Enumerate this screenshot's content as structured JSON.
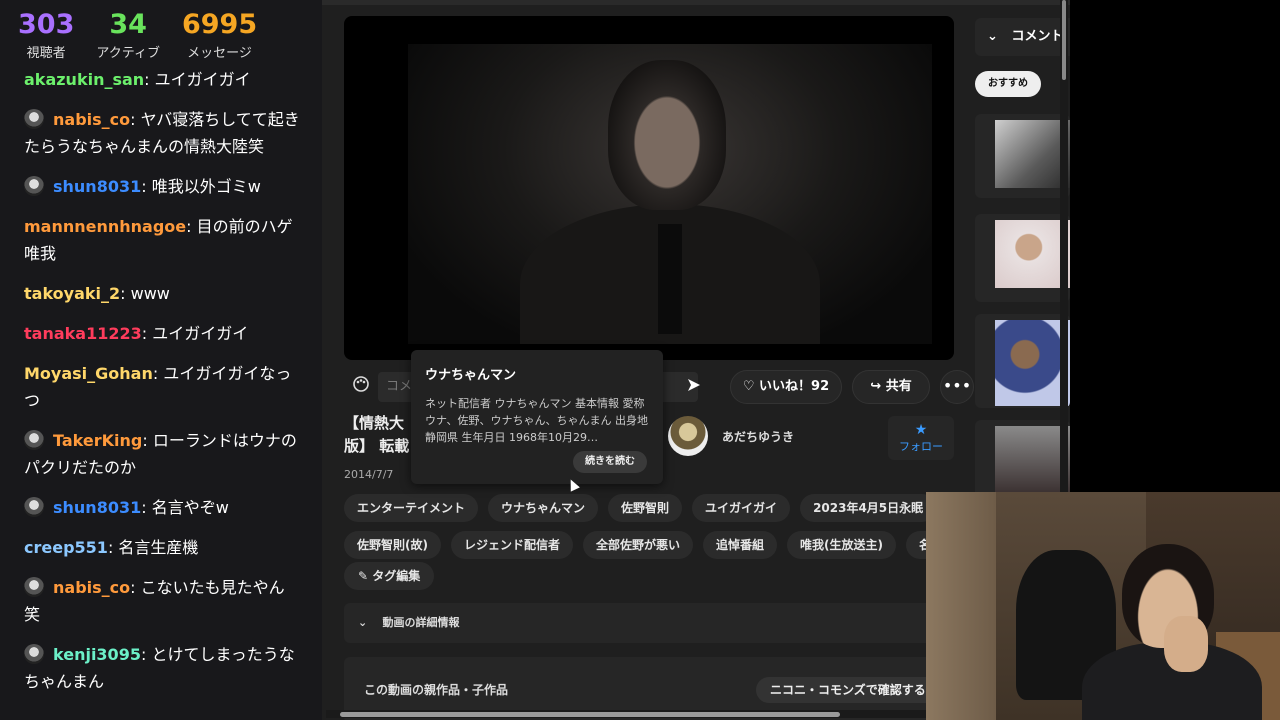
{
  "stats": [
    {
      "num": "303",
      "label": "視聴者",
      "color": "#a970ff"
    },
    {
      "num": "34",
      "label": "アクティブ",
      "color": "#69e35c"
    },
    {
      "num": "6995",
      "label": "メッセージ",
      "color": "#f5a623"
    }
  ],
  "chat": [
    {
      "user": "akazukin_san",
      "text": "ユイガイガイ",
      "color": "#6cf06c",
      "badge": false
    },
    {
      "user": "nabis_co",
      "text": "ヤバ寝落ちしてて起きたらうなちゃんまんの情熱大陸笑",
      "color": "#ff9a3c",
      "badge": true
    },
    {
      "user": "shun8031",
      "text": "唯我以外ゴミw",
      "color": "#3c8cff",
      "badge": true
    },
    {
      "user": "mannnennhnagoe",
      "text": "目の前のハゲ唯我",
      "color": "#ff9a3c",
      "badge": false
    },
    {
      "user": "takoyaki_2",
      "text": "www",
      "color": "#ffd76a",
      "badge": false
    },
    {
      "user": "tanaka11223",
      "text": "ユイガイガイ",
      "color": "#ff3c5c",
      "badge": false
    },
    {
      "user": "Moyasi_Gohan",
      "text": "ユイガイガイなっつ",
      "color": "#ffd76a",
      "badge": false
    },
    {
      "user": "TakerKing",
      "text": "ローランドはウナのパクリだたのか",
      "color": "#ff9a3c",
      "badge": true
    },
    {
      "user": "shun8031",
      "text": "名言やぞw",
      "color": "#3c8cff",
      "badge": true
    },
    {
      "user": "creep551",
      "text": "名言生産機",
      "color": "#8cc8ff",
      "badge": false
    },
    {
      "user": "nabis_co",
      "text": "こないたも見たやん笑",
      "color": "#ff9a3c",
      "badge": true
    },
    {
      "user": "kenji3095",
      "text": "とけてしまったうなちゃんまん",
      "color": "#6cf0c8",
      "badge": true
    }
  ],
  "player": {
    "comment_placeholder": "コメ",
    "like_label": "いいね！92",
    "share_label": "共有",
    "more_label": "•••"
  },
  "video": {
    "title_line1": "【情熱大",
    "title_line2": "版】 転載",
    "date": "2014/7/7",
    "owner_name": "あだちゆうき",
    "follow_label": "フォロー"
  },
  "tags_row1": [
    "エンターテイメント",
    "ウナちゃんマン",
    "佐野智則",
    "ユイガイガイ",
    "2023年4月5日永眠"
  ],
  "tags_row2": [
    "佐野智則(故)",
    "レジェンド配信者",
    "全部佐野が悪い",
    "追悼番組",
    "唯我(生放送主)",
    "名作"
  ],
  "tag_edit_label": "タグ編集",
  "details_label": "動画の詳細情報",
  "parents": {
    "title": "この動画の親作品・子作品",
    "button": "ニコニ・コモンズで確認する"
  },
  "sidebar": {
    "comment_header": "コメント",
    "recommend_label": "おすすめ"
  },
  "tooltip": {
    "name": "ウナちゃんマン",
    "description": "ネット配信者 ウナちゃんマン 基本情報 愛称 ウナ、佐野、ウナちゃん、ちゃんまん 出身地 静岡県 生年月日 1968年10月29…",
    "more_label": "続きを読む"
  }
}
